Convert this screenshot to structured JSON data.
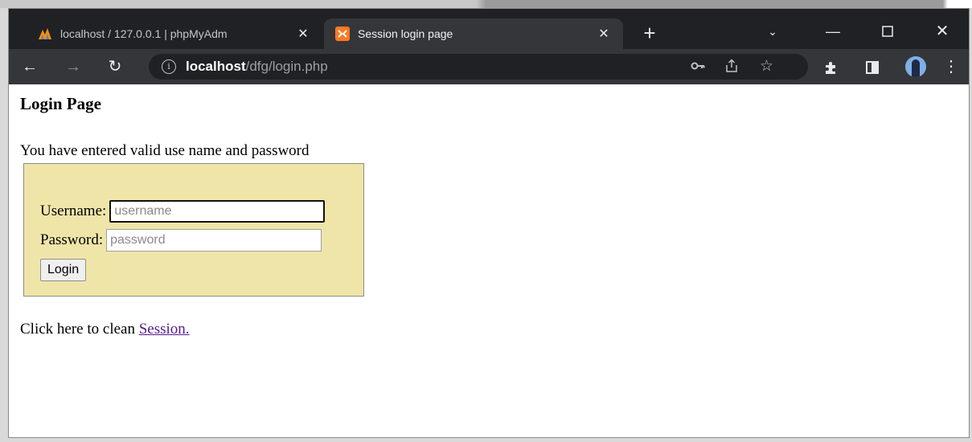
{
  "browser": {
    "tabs": [
      {
        "title": "localhost / 127.0.0.1 | phpMyAdm",
        "icon": "phpmyadmin-icon",
        "active": false
      },
      {
        "title": "Session login page",
        "icon": "xampp-icon",
        "active": true
      }
    ],
    "address": {
      "host": "localhost",
      "path": "/dfg/login.php"
    },
    "colors": {
      "tabbar": "#202124",
      "toolbar": "#35363a",
      "omnibox": "#202124"
    }
  },
  "page": {
    "heading": "Login Page",
    "message": "You have entered valid use name and password",
    "form": {
      "username_label": "Username:",
      "username_placeholder": "username",
      "password_label": "Password:",
      "password_placeholder": "password",
      "login_label": "Login",
      "background": "#f0e5a8"
    },
    "footer": {
      "text": "Click here to clean ",
      "link": "Session."
    }
  }
}
